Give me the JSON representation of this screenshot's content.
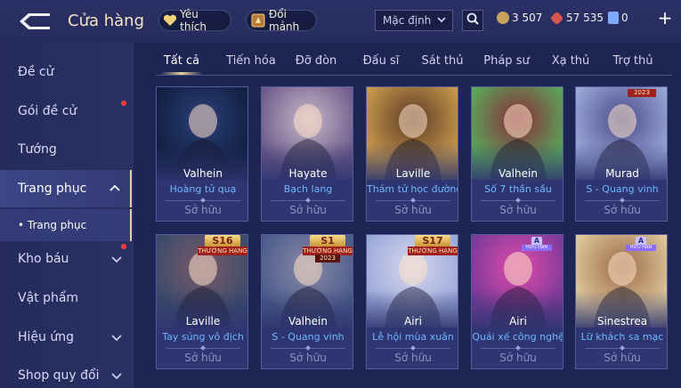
{
  "header": {
    "title": "Cửa hàng",
    "favorites_label": "Yêu thích",
    "exchange_label": "Đổi mảnh",
    "sort_value": "Mặc định",
    "currencies": [
      {
        "name": "gold-coin",
        "value": "3 507",
        "color": "#c8a45a"
      },
      {
        "name": "red-gem",
        "value": "57 535",
        "color": "#d9534f"
      },
      {
        "name": "voucher",
        "value": "0",
        "color": "#7fa8ff"
      }
    ],
    "plus_label": "+"
  },
  "sidebar": {
    "items": [
      {
        "label": "Đề cử"
      },
      {
        "label": "Gói đề cử"
      },
      {
        "label": "Tướng"
      },
      {
        "label": "Trang phục"
      },
      {
        "label": "• Trang phục"
      },
      {
        "label": "Kho báu"
      },
      {
        "label": "Vật phẩm"
      },
      {
        "label": "Hiệu ứng"
      },
      {
        "label": "Shop quy đổi"
      }
    ]
  },
  "tabs": [
    {
      "label": "Tất cả"
    },
    {
      "label": "Tiến hóa"
    },
    {
      "label": "Đỡ đòn"
    },
    {
      "label": "Đấu sĩ"
    },
    {
      "label": "Sát thủ"
    },
    {
      "label": "Pháp sư"
    },
    {
      "label": "Xạ thủ"
    },
    {
      "label": "Trợ thủ"
    }
  ],
  "cards": [
    {
      "hero": "Valhein",
      "skin": "Hoàng tử quạ",
      "status": "Sở hữu",
      "colors": [
        "#0f1f3f",
        "#2d3f7a"
      ]
    },
    {
      "hero": "Hayate",
      "skin": "Bạch lang",
      "status": "Sở hữu",
      "colors": [
        "#6b5a8a",
        "#c9b8c8"
      ]
    },
    {
      "hero": "Laville",
      "skin": "Thám tử học đường",
      "status": "Sở hữu",
      "colors": [
        "#c99a4a",
        "#5b3a28"
      ]
    },
    {
      "hero": "Valhein",
      "skin": "Số 7 thần sầu",
      "status": "Sở hữu",
      "colors": [
        "#5aa85a",
        "#8a2a3a"
      ]
    },
    {
      "hero": "Murad",
      "skin": "S - Quang vinh",
      "status": "Sở hữu",
      "colors": [
        "#9aa8d8",
        "#4a4a8a"
      ],
      "badge": {
        "main": "",
        "sub": "",
        "year": "2023"
      }
    },
    {
      "hero": "Laville",
      "skin": "Tay súng vô địch",
      "status": "Sở hữu",
      "colors": [
        "#3a4a6a",
        "#7a5a6a"
      ],
      "badge": {
        "main": "S16",
        "sub": "THƯỜNG HẠNG",
        "year": ""
      }
    },
    {
      "hero": "Valhein",
      "skin": "S - Quang vinh",
      "status": "Sở hữu",
      "colors": [
        "#4a5a8a",
        "#8a8aa8"
      ],
      "badge": {
        "main": "S1",
        "sub": "THƯỜNG HẠNG",
        "year": "2023"
      }
    },
    {
      "hero": "Airi",
      "skin": "Lễ hội mùa xuân",
      "status": "Sở hữu",
      "colors": [
        "#9aa8d8",
        "#d8d8f0"
      ],
      "badge": {
        "main": "S17",
        "sub": "THƯỜNG HẠNG",
        "year": ""
      }
    },
    {
      "hero": "Airi",
      "skin": "Quái xế công nghệ",
      "status": "Sở hữu",
      "colors": [
        "#7a3a9a",
        "#e04aa8"
      ],
      "abadge": {
        "main": "A",
        "sub": "HỮU HẠN"
      }
    },
    {
      "hero": "Sinestrea",
      "skin": "Lữ khách sa mạc",
      "status": "Sở hữu",
      "colors": [
        "#e0c89a",
        "#9a6a4a"
      ],
      "abadge": {
        "main": "A",
        "sub": "HỮU HẠN"
      }
    }
  ]
}
